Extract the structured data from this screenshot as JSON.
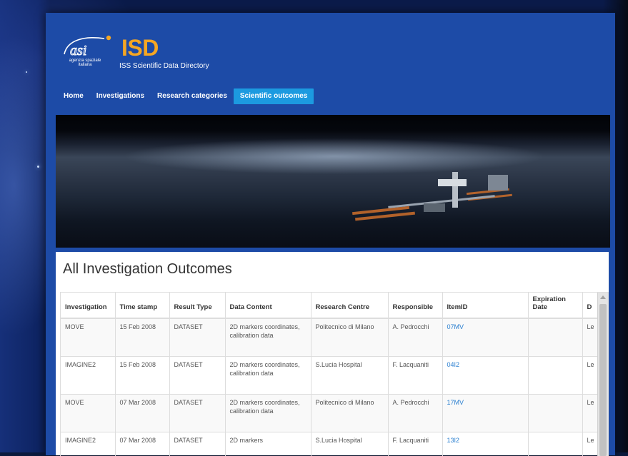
{
  "logo": {
    "sub_line1": "agenzia spaziale",
    "sub_line2": "italiana",
    "mark": "ISD",
    "tagline": "ISS Scientific Data Directory"
  },
  "colors": {
    "nav_active": "#1c9ae0",
    "page_bg": "#1d4ba7",
    "logo_accent": "#f5a623",
    "link": "#2a7fd0"
  },
  "nav": {
    "items": [
      {
        "label": "Home",
        "active": false
      },
      {
        "label": "Investigations",
        "active": false
      },
      {
        "label": "Research categories",
        "active": false
      },
      {
        "label": "Scientific outcomes",
        "active": true
      }
    ]
  },
  "page_title": "All Investigation Outcomes",
  "table": {
    "headers": [
      "Investigation",
      "Time stamp",
      "Result Type",
      "Data Content",
      "Research Centre",
      "Responsible",
      "ItemID",
      "Expiration Date",
      "D"
    ],
    "rows": [
      [
        "MOVE",
        "15 Feb 2008",
        "DATASET",
        "2D markers coordinates, calibration data",
        "Politecnico di Milano",
        "A. Pedrocchi",
        "07MV",
        "",
        "Le"
      ],
      [
        "IMAGINE2",
        "15 Feb 2008",
        "DATASET",
        "2D markers coordinates, calibration data",
        "S.Lucia Hospital",
        "F. Lacquaniti",
        "04I2",
        "",
        "Le"
      ],
      [
        "MOVE",
        "07 Mar 2008",
        "DATASET",
        "2D markers coordinates, calibration data",
        "Politecnico di Milano",
        "A. Pedrocchi",
        "17MV",
        "",
        "Le"
      ],
      [
        "IMAGINE2",
        "07 Mar 2008",
        "DATASET",
        "2D markers",
        "S.Lucia Hospital",
        "F. Lacquaniti",
        "13I2",
        "",
        "Le"
      ]
    ]
  }
}
